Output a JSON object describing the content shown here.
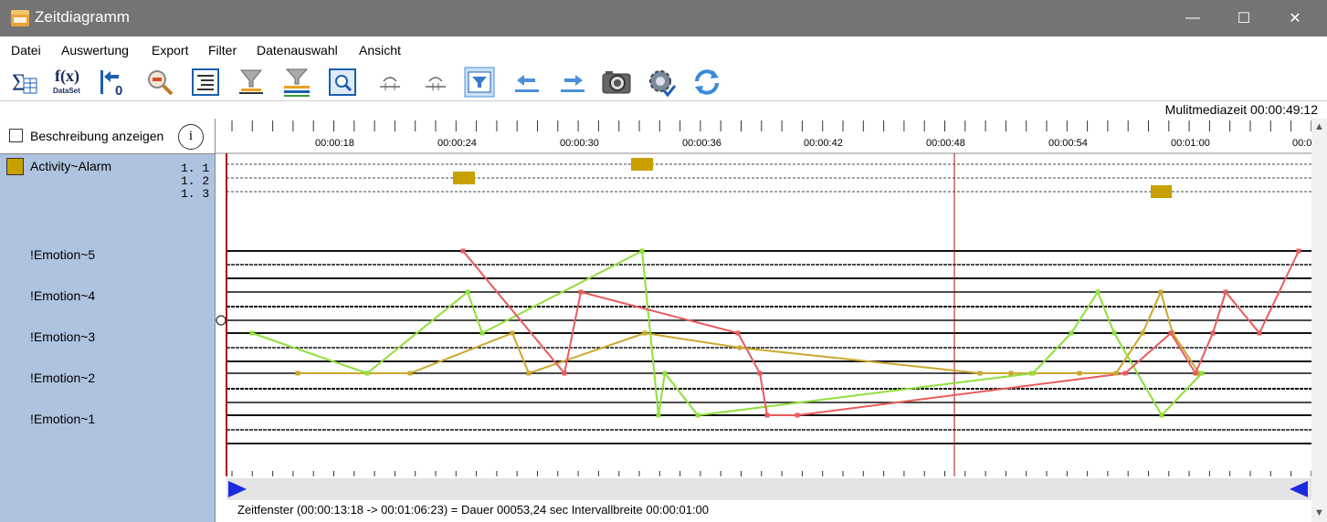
{
  "window": {
    "title": "Zeitdiagramm",
    "minimize": "—",
    "maximize": "☐",
    "close": "✕"
  },
  "menu": [
    "Datei",
    "Auswertung",
    "Export",
    "Filter",
    "Datenauswahl",
    "Ansicht"
  ],
  "toolbar": {
    "buttons": [
      "sum-table-icon",
      "fx-dataset-icon",
      "jump-to-start-icon",
      "zoom-out-icon",
      "list-view-icon",
      "filter-icon",
      "filter-bars-icon",
      "search-icon",
      "collapse-icon",
      "expand-icon",
      "timeline-filter-icon",
      "arrow-left-icon",
      "arrow-right-icon",
      "camera-icon",
      "settings-icon",
      "refresh-icon"
    ],
    "fx_label": "f(x)",
    "dataset_label": "DataSet"
  },
  "multimedia_time": "Mulitmediazeit 00:00:49:12",
  "left_panel": {
    "checkbox_label": "Beschreibung anzeigen",
    "info_label": "i",
    "activity_label": "Activity~Alarm",
    "activity_sub": [
      "1. 1",
      "1. 2",
      "1. 3"
    ],
    "emotion_labels": [
      "!Emotion~5",
      "!Emotion~4",
      "!Emotion~3",
      "!Emotion~2",
      "!Emotion~1"
    ]
  },
  "timeline": {
    "tick_labels": [
      "00:00:18",
      "00:00:24",
      "00:00:30",
      "00:00:36",
      "00:00:42",
      "00:00:48",
      "00:00:54",
      "00:01:00",
      "00:0"
    ]
  },
  "footer": "Zeitfenster  (00:00:13:18 -> 00:01:06:23) = Dauer 00053,24 sec   Intervallbreite 00:00:01:00",
  "colors": {
    "green": "#8fe03a",
    "red": "#e85c5c",
    "gold": "#c9a82e",
    "alarm": "#c8a000",
    "cursor": "#a01010",
    "panel": "#aec3df"
  }
}
